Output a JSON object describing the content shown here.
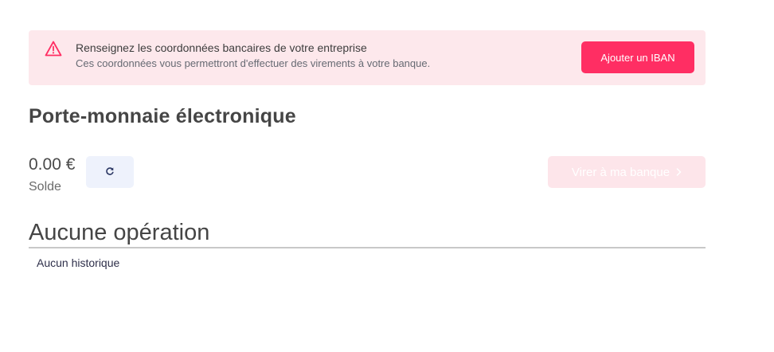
{
  "alert": {
    "icon": "warning-icon",
    "title": "Renseignez les coordonnées bancaires de votre entreprise",
    "subtitle": "Ces coordonnées vous permettront d'effectuer des virements à votre banque.",
    "button_label": "Ajouter un IBAN",
    "colors": {
      "background": "#fde8ec",
      "accent": "#ff2e63"
    }
  },
  "wallet": {
    "title": "Porte-monnaie électronique",
    "balance": "0.00 €",
    "balance_label": "Solde",
    "refresh_icon": "refresh-icon",
    "transfer_label": "Virer à ma banque",
    "transfer_icon": "chevron-right-icon",
    "transfer_disabled": true
  },
  "operations": {
    "title": "Aucune opération",
    "empty_text": "Aucun historique"
  }
}
